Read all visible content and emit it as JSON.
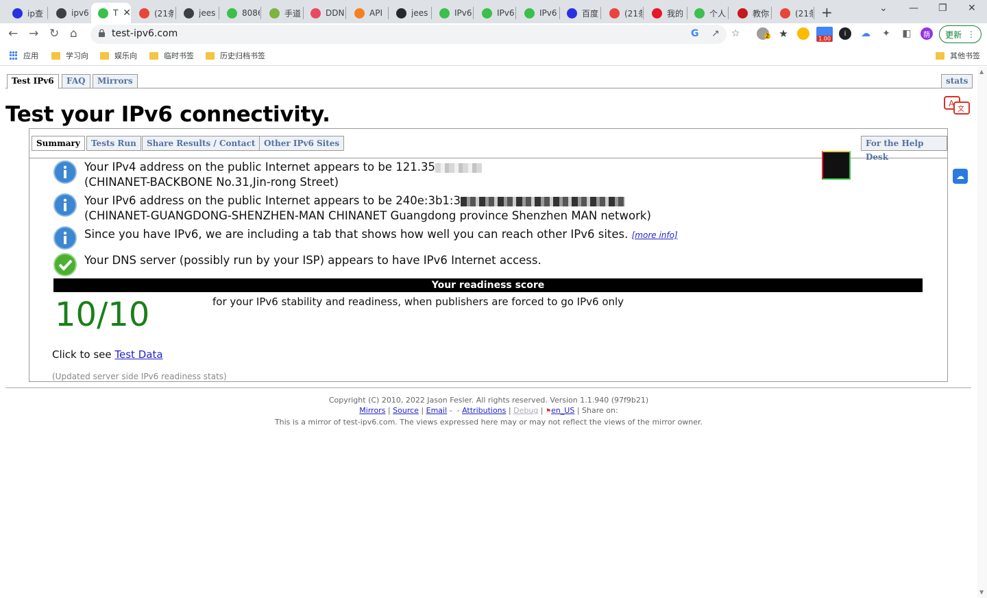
{
  "tabs": [
    {
      "title": "ip查",
      "favicon": "baidu-paw-icon",
      "color": "#2932e1"
    },
    {
      "title": "ipv6",
      "favicon": "circle-icon",
      "color": "#3c4043"
    },
    {
      "title": "T",
      "favicon": "check-circle-icon",
      "color": "#3ac04b",
      "active": true
    },
    {
      "title": "(21条",
      "favicon": "c-logo-icon",
      "color": "#e8453c"
    },
    {
      "title": "jees",
      "favicon": "circle-icon",
      "color": "#3c4043"
    },
    {
      "title": "8086",
      "favicon": "n-logo-icon",
      "color": "#3ac04b"
    },
    {
      "title": "手道",
      "favicon": "leaf-icon",
      "color": "#7db33f"
    },
    {
      "title": "DDN",
      "favicon": "ddn-icon",
      "color": "#e84a5f"
    },
    {
      "title": "API",
      "favicon": "cloud-icon",
      "color": "#f48120"
    },
    {
      "title": "jees",
      "favicon": "github-icon",
      "color": "#24292e"
    },
    {
      "title": "IPv6",
      "favicon": "check-circle-icon",
      "color": "#3ac04b"
    },
    {
      "title": "IPv6",
      "favicon": "check-circle-icon",
      "color": "#3ac04b"
    },
    {
      "title": "IPv6",
      "favicon": "check-circle-icon",
      "color": "#3ac04b"
    },
    {
      "title": "百度",
      "favicon": "baidu-paw-icon",
      "color": "#2932e1"
    },
    {
      "title": "(21条",
      "favicon": "c-logo-icon",
      "color": "#e8453c"
    },
    {
      "title": "我的",
      "favicon": "weibo-icon",
      "color": "#e6162d"
    },
    {
      "title": "个人",
      "favicon": "check-circle-icon",
      "color": "#3ac04b"
    },
    {
      "title": "教你",
      "favicon": "m-logo-icon",
      "color": "#c41a1a"
    },
    {
      "title": "(21条",
      "favicon": "c-logo-icon",
      "color": "#e8453c"
    }
  ],
  "toolbar": {
    "url": "test-ipv6.com",
    "update_label": "更新",
    "ext_badge_count": "2",
    "ext_price": "1.00"
  },
  "bookmarks": {
    "apps": "应用",
    "items": [
      "学习向",
      "娱乐向",
      "临时书签",
      "历史归档书签"
    ],
    "other": "其他书签"
  },
  "page": {
    "top_tabs": {
      "test_ipv6": "Test IPv6",
      "faq": "FAQ",
      "mirrors": "Mirrors",
      "stats": "stats"
    },
    "headline": "Test your IPv6 connectivity.",
    "sub_tabs": {
      "summary": "Summary",
      "tests_run": "Tests Run",
      "share": "Share Results / Contact",
      "other_sites": "Other IPv6 Sites",
      "help_desk": "For the Help Desk"
    },
    "messages": {
      "ipv4_prefix": "Your IPv4 address on the public Internet appears to be 121.35",
      "ipv4_isp": "(CHINANET-BACKBONE No.31,Jin-rong Street)",
      "ipv6_prefix": "Your IPv6 address on the public Internet appears to be 240e:3b1:3",
      "ipv6_isp": "(CHINANET-GUANGDONG-SHENZHEN-MAN CHINANET Guangdong province Shenzhen MAN network)",
      "ipv6_tab": "Since you have IPv6, we are including a tab that shows how well you can reach other IPv6 sites.",
      "more_info": "[more info]",
      "dns": "Your DNS server (possibly run by your ISP) appears to have IPv6 Internet access."
    },
    "score": {
      "bar_title": "Your readiness score",
      "value": "10/10",
      "note": "for your IPv6 stability and readiness, when publishers are forced to go IPv6 only"
    },
    "click_prefix": "Click to see ",
    "test_data_link": "Test Data",
    "updated": "(Updated server side IPv6 readiness stats)",
    "footer": {
      "copyright": "Copyright (C) 2010, 2022 Jason Fesler. All rights reserved. Version 1.1.940 (97f9b21)",
      "mirrors": "Mirrors",
      "source": "Source",
      "email": "Email",
      "attributions": "Attributions",
      "debug": "Debug",
      "locale": "en_US",
      "share_on": "Share on:",
      "mirror_note": "This is a mirror of test-ipv6.com. The views expressed here may or may not reflect the views of the mirror owner."
    }
  }
}
